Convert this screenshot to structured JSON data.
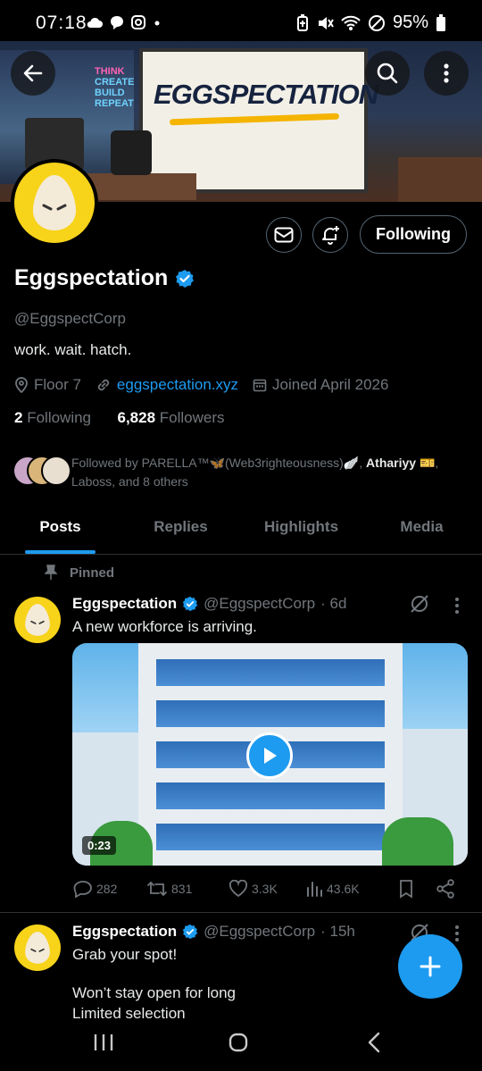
{
  "status_bar": {
    "time": "07:18",
    "battery": "95%",
    "icons": [
      "cloud-icon",
      "chat-icon",
      "instagram-icon",
      "dot-icon",
      "battery-saver-icon",
      "mute-icon",
      "wifi-icon",
      "dnd-icon",
      "battery-icon"
    ]
  },
  "banner": {
    "neon_lines": [
      "THINK",
      "CREATE",
      "BUILD",
      "REPEAT"
    ],
    "board_title": "EGGSPECTATION"
  },
  "profile": {
    "display_name": "Eggspectation",
    "verified": true,
    "handle": "@EggspectCorp",
    "bio": "work. wait. hatch.",
    "location": "Floor 7",
    "website": "eggspectation.xyz",
    "joined": "Joined April 2026",
    "following_count": "2",
    "following_label": "Following",
    "followers_count": "6,828",
    "followers_label": "Followers",
    "follow_button": "Following",
    "followed_by_prefix": "Followed by ",
    "followed_by_name1": "PARELLA™🦋(Web3righteousness)🪽",
    "followed_by_sep": ", ",
    "followed_by_name2": "Athariyy 🎫",
    "followed_by_suffix": ",",
    "followed_by_rest": "Laboss, and 8 others"
  },
  "tabs": [
    {
      "label": "Posts",
      "active": true
    },
    {
      "label": "Replies",
      "active": false
    },
    {
      "label": "Highlights",
      "active": false
    },
    {
      "label": "Media",
      "active": false
    }
  ],
  "pinned_label": "Pinned",
  "posts": [
    {
      "name": "Eggspectation",
      "handle": "@EggspectCorp",
      "time": "· 6d",
      "text": "A new workforce is arriving.",
      "video_duration": "0:23",
      "replies": "282",
      "reposts": "831",
      "likes": "3.3K",
      "views": "43.6K"
    },
    {
      "name": "Eggspectation",
      "handle": "@EggspectCorp",
      "time": "· 15h",
      "text_line1": "Grab your spot!",
      "text_line2": "Won’t stay open for long",
      "text_line3": "Limited selection"
    }
  ],
  "colors": {
    "background": "#000000",
    "accent": "#1d9bf0",
    "secondary_text": "#71767b",
    "avatar_yellow": "#f7d31a"
  }
}
